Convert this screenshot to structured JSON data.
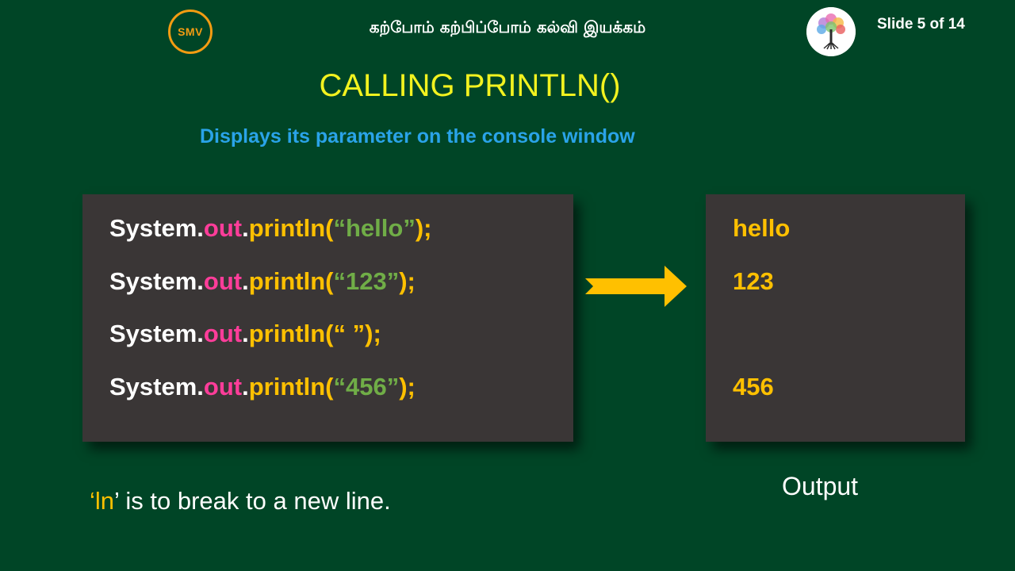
{
  "header": {
    "logo_text": "SMV",
    "title": "கற்போம் கற்பிப்போம் கல்வி இயக்கம்",
    "slide_counter": "Slide 5 of 14"
  },
  "slide": {
    "title": "CALLING PRINTLN()",
    "subtitle": "Displays its parameter on the console window"
  },
  "code": {
    "lines": [
      {
        "obj": "System",
        "dot1": ".",
        "field": "out",
        "dot2": ".",
        "method": "println(",
        "arg": "“hello”",
        "end": ");"
      },
      {
        "obj": "System",
        "dot1": ".",
        "field": "out",
        "dot2": ".",
        "method": "println(",
        "arg": "“123”",
        "end": ");"
      },
      {
        "obj": "System",
        "dot1": ".",
        "field": "out",
        "dot2": ".",
        "method": "println(",
        "arg": "“ ”",
        "end": ");"
      },
      {
        "obj": "System",
        "dot1": ".",
        "field": "out",
        "dot2": ".",
        "method": "println(",
        "arg": "“456”",
        "end": ");"
      }
    ]
  },
  "output": {
    "lines": [
      "hello",
      "123",
      "",
      "456"
    ],
    "label": "Output"
  },
  "note": {
    "quote_open": "‘",
    "highlight": "ln",
    "quote_close": "’",
    "rest": " is to break to a new line."
  },
  "colors": {
    "background": "#004526",
    "title": "#f2f21f",
    "subtitle": "#2aa3e8",
    "code_panel": "#3a3636",
    "keyword_out": "#ff3d9a",
    "method": "#ffc000",
    "string": "#70ad47",
    "arrow": "#ffc000"
  },
  "icons": {
    "smv_logo": "smv-logo-icon",
    "tree_logo": "tree-logo-icon",
    "arrow": "right-arrow-icon"
  }
}
